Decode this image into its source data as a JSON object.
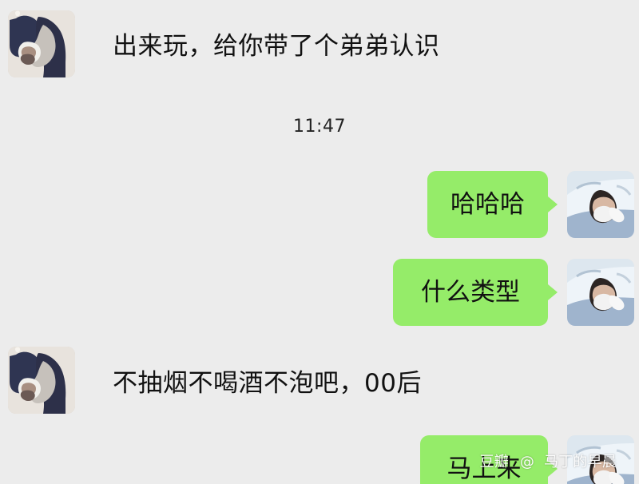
{
  "messages": {
    "m1": "出来玩，给你带了个弟弟认识",
    "time": "11:47",
    "m2": "哈哈哈",
    "m3": "什么类型",
    "m4": "不抽烟不喝酒不泡吧，00后",
    "m5": "马上来"
  },
  "watermark": {
    "site": "豆瓣",
    "at": "@",
    "user": "马丁的早晨"
  },
  "colors": {
    "background": "#ececec",
    "outgoing_bubble": "#95ec69",
    "text": "#111111"
  },
  "icons": {
    "incoming_avatar": "contact-avatar-icon",
    "outgoing_avatar": "self-avatar-icon"
  }
}
